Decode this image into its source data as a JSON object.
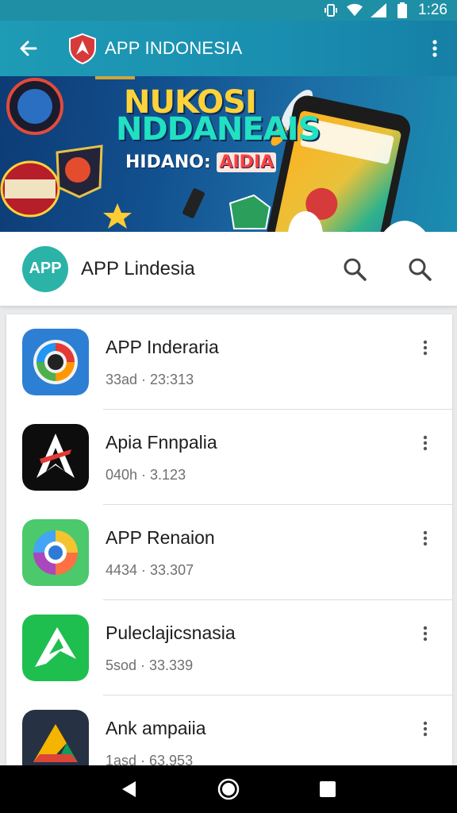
{
  "status_bar": {
    "time": "1:26",
    "icons": [
      "vibrate-icon",
      "wifi-icon",
      "signal-icon",
      "battery-icon"
    ]
  },
  "app_bar": {
    "title": "APP INDONESIA",
    "back_icon": "arrow-back-icon",
    "logo_icon": "shield-logo-icon",
    "more_icon": "more-vert-icon",
    "color": "#1e9bb5"
  },
  "banner": {
    "headline_line1": "NUKOSI",
    "headline_line2": "NDDANEAIS",
    "subline_text": "HIDANO: ",
    "subline_accent": "AIDIA"
  },
  "app_header": {
    "avatar_text": "APP",
    "avatar_caption": "",
    "name": "APP Lindesia",
    "search_icons": [
      "search-icon",
      "search-icon"
    ],
    "avatar_color": "#2bb3a8"
  },
  "apps": [
    {
      "title": "APP Inderaria",
      "meta": "33ad · 23:313",
      "icon": "sync-circle-icon"
    },
    {
      "title": "Apia Fnnpalia",
      "meta": "040h · 3.123",
      "icon": "arrow-logo-icon"
    },
    {
      "title": "APP Renaion",
      "meta": "4434 · 33.307",
      "icon": "chrome-like-icon"
    },
    {
      "title": "Puleclajicsnasia",
      "meta": "5sod · 33.339",
      "icon": "green-arrow-icon"
    },
    {
      "title": "Ank ampaiia",
      "meta": "1asd · 63.953",
      "icon": "triangle-logo-icon"
    }
  ],
  "nav_bar": {
    "buttons": [
      "back-nav-icon",
      "home-nav-icon",
      "recents-nav-icon"
    ]
  }
}
